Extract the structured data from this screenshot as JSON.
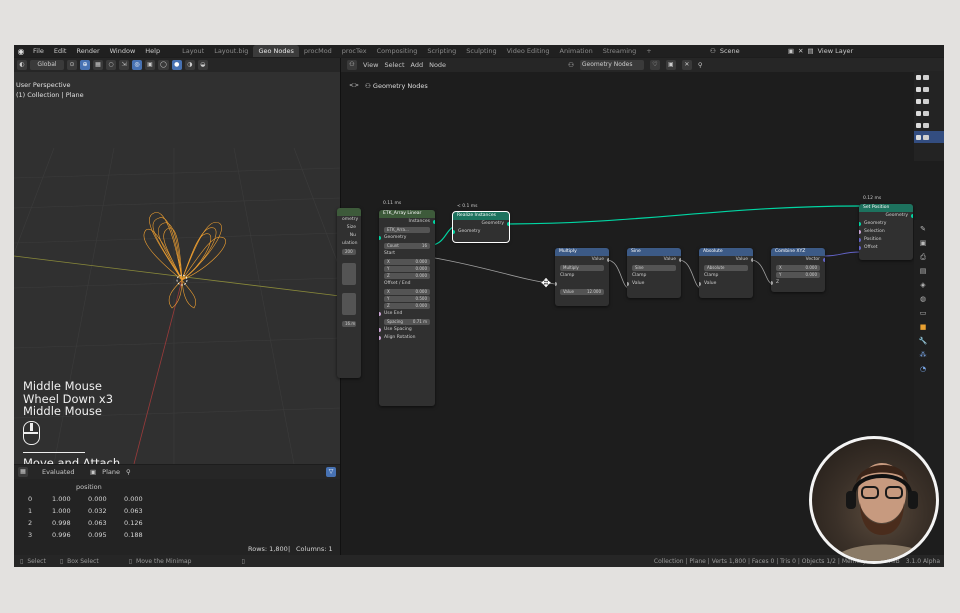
{
  "topbar": {
    "menu": [
      "File",
      "Edit",
      "Render",
      "Window",
      "Help"
    ],
    "workspaces": [
      {
        "label": "Layout",
        "active": false
      },
      {
        "label": "Layout.big",
        "active": false
      },
      {
        "label": "Geo Nodes",
        "active": true
      },
      {
        "label": "procMod",
        "active": false
      },
      {
        "label": "procTex",
        "active": false
      },
      {
        "label": "Compositing",
        "active": false
      },
      {
        "label": "Scripting",
        "active": false
      },
      {
        "label": "Sculpting",
        "active": false
      },
      {
        "label": "Video Editing",
        "active": false
      },
      {
        "label": "Animation",
        "active": false
      },
      {
        "label": "Streaming",
        "active": false
      }
    ],
    "add_tab": "+",
    "scene": "Scene",
    "view_layer": "View Layer"
  },
  "viewport": {
    "orientation": "Global",
    "perspective": "User Perspective",
    "collection": "(1) Collection | Plane",
    "keys": [
      "Middle Mouse",
      "Wheel Down x3",
      "Middle Mouse"
    ],
    "operator": "Move and Attach"
  },
  "spreadsheet": {
    "mode": "Evaluated",
    "object": "Plane",
    "column": "position",
    "rows": [
      {
        "index": "0",
        "x": "1.000",
        "y": "0.000",
        "z": "0.000"
      },
      {
        "index": "1",
        "x": "1.000",
        "y": "0.032",
        "z": "0.063"
      },
      {
        "index": "2",
        "x": "0.998",
        "y": "0.063",
        "z": "0.126"
      },
      {
        "index": "3",
        "x": "0.996",
        "y": "0.095",
        "z": "0.188"
      }
    ],
    "rows_count": "Rows: 1,800",
    "columns_count": "Columns: 1"
  },
  "editor": {
    "menu": [
      "View",
      "Select",
      "Add",
      "Node"
    ],
    "tree": "Geometry Nodes",
    "breadcrumb": "Geometry Nodes",
    "nodes": {
      "partial": {
        "rows": [
          "ometry",
          "Size",
          "Nu",
          "ulation",
          "200",
          "16.m"
        ]
      },
      "array": {
        "timing": "0.11 ms",
        "title": "ETK_Array Linear",
        "out": "Instances",
        "select": "ETK_Arra...",
        "geometry": "Geometry",
        "count": "Count",
        "count_val": "16",
        "start": "Start",
        "start_vals": [
          "0.000",
          "0.000",
          "0.000"
        ],
        "offset": "Offset / End",
        "offset_vals": [
          "0.000",
          "0.500",
          "0.000"
        ],
        "use_end": "Use End",
        "spacing": "Spacing",
        "spacing_val": "0.71 m",
        "use_spacing": "Use Spacing",
        "align": "Align Rotation"
      },
      "realize": {
        "timing": "< 0.1 ms",
        "title": "Realize Instances",
        "out": "Geometry",
        "in": "Geometry"
      },
      "multiply": {
        "title": "Multiply",
        "out": "Value",
        "op": "Multiply",
        "clamp": "Clamp",
        "val_label": "Value",
        "val": "12.000"
      },
      "sine": {
        "title": "Sine",
        "out": "Value",
        "op": "Sine",
        "clamp": "Clamp",
        "in": "Value"
      },
      "absolute": {
        "title": "Absolute",
        "out": "Value",
        "op": "Absolute",
        "clamp": "Clamp",
        "in": "Value"
      },
      "combine": {
        "title": "Combine XYZ",
        "out": "Vector",
        "x": "0.000",
        "y": "0.000",
        "z": "Z"
      },
      "setpos": {
        "timing": "0.12 ms",
        "title": "Set Position",
        "out": "Geometry",
        "rows": [
          "Geometry",
          "Selection",
          "Position",
          "Offset"
        ]
      }
    }
  },
  "statusbar": {
    "select": "Select",
    "box_select": "Box Select",
    "move": "Move the Minimap",
    "info": "Collection | Plane | Verts 1,800 | Faces 0 | Tris 0 | Objects 1/2 | Memory: 249.5 MiB",
    "version": "3.1.0 Alpha"
  },
  "colors": {
    "accent": "#4772b3",
    "node_link_geometry": "#00d6a3",
    "wire": "#ff9a1e"
  }
}
